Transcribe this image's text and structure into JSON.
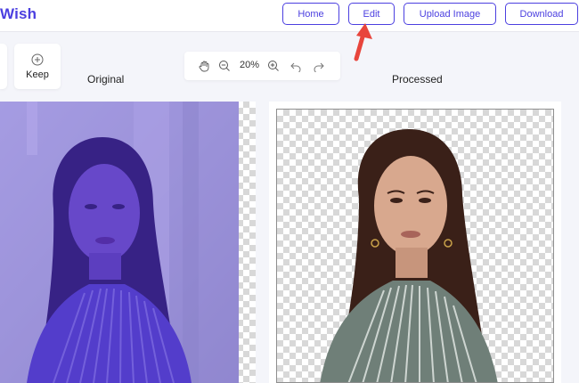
{
  "header": {
    "brand": "Wish",
    "nav": {
      "home": "Home",
      "edit": "Edit",
      "upload": "Upload Image",
      "download": "Download"
    }
  },
  "toolbar": {
    "keep_label": "Keep"
  },
  "zoom": {
    "level": "20%",
    "icons": [
      "hand-icon",
      "zoom-out-icon",
      "zoom-in-icon",
      "undo-icon",
      "redo-icon"
    ]
  },
  "panels": {
    "original_label": "Original",
    "processed_label": "Processed"
  },
  "colors": {
    "accent": "#4b3fe0",
    "arrow": "#e8453c",
    "original_tint": "#4a2fd0"
  }
}
